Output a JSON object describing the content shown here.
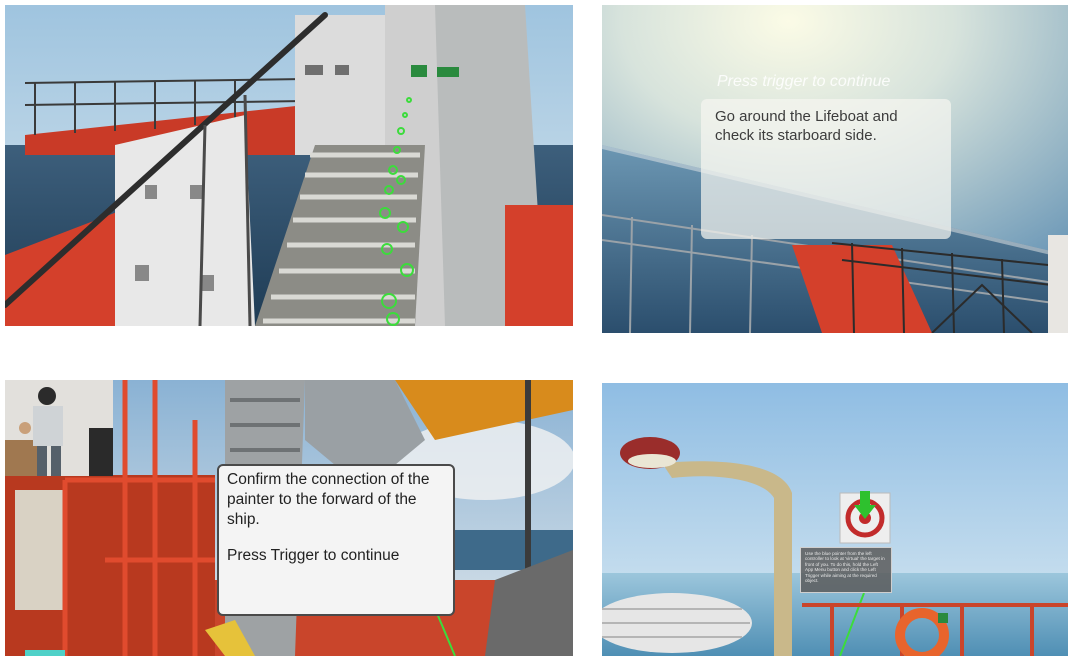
{
  "panels": {
    "staircase": {
      "sign_icons": [
        "exit-sign-icon",
        "exit-sign-icon"
      ]
    },
    "lifeboat_check": {
      "hint": "Press trigger to continue",
      "instruction": "Go around the Lifeboat and check its starboard side."
    },
    "painter_connection": {
      "instruction": "Confirm the connection of the painter to the forward of the ship.",
      "prompt": "Press Trigger to continue"
    },
    "target_tutorial": {
      "instruction": "Use the blue pointer from the left controller to look at 'virtual' the target in front of you. To do this, hold the Left App Menu button and click the Left Trigger while aiming at the required object."
    }
  },
  "colors": {
    "sky": "#8fb7d6",
    "sea": "#2e4d68",
    "deck_red": "#d7412c",
    "pointer_green": "#3cdc3c",
    "box_white": "#f4f4f4"
  }
}
